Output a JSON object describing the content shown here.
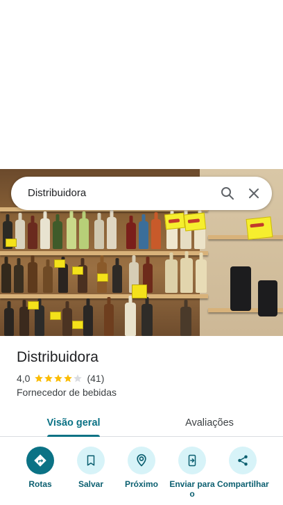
{
  "search": {
    "query": "Distribuidora"
  },
  "place": {
    "name": "Distribuidora",
    "rating": "4,0",
    "rating_value": 4.0,
    "review_count": "(41)",
    "category": "Fornecedor de bebidas"
  },
  "tabs": [
    {
      "label": "Visão geral",
      "active": true
    },
    {
      "label": "Avaliações",
      "active": false
    }
  ],
  "actions": [
    {
      "label": "Rotas",
      "icon": "directions-icon"
    },
    {
      "label": "Salvar",
      "icon": "bookmark-icon"
    },
    {
      "label": "Próximo",
      "icon": "nearby-icon"
    },
    {
      "label": "Enviar para o",
      "icon": "send-to-phone-icon"
    },
    {
      "label": "Compartilhar",
      "icon": "share-icon"
    }
  ],
  "colors": {
    "accent": "#0b7285",
    "accent_light": "#d7f3f8",
    "star": "#fbbc04",
    "star_empty": "#dadce0"
  }
}
